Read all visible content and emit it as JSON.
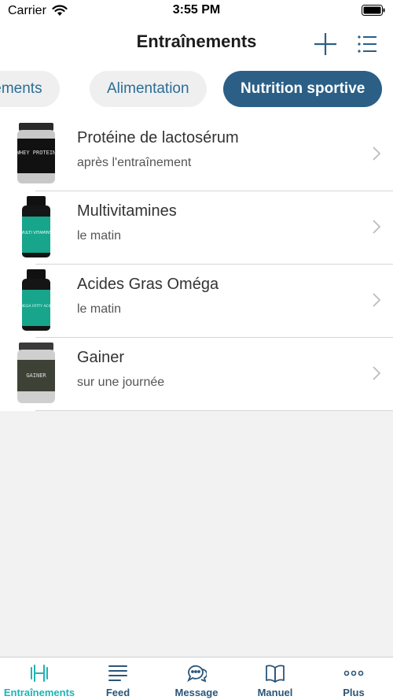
{
  "status_bar": {
    "carrier": "Carrier",
    "time": "3:55 PM"
  },
  "nav": {
    "title": "Entraînements"
  },
  "chips": [
    {
      "label": "Entraînements"
    },
    {
      "label": "Alimentation"
    },
    {
      "label": "Nutrition sportive"
    }
  ],
  "items": [
    {
      "title": "Protéine de lactosérum",
      "subtitle": "après l'entraînement",
      "image_text": "WHEY PROTEIN"
    },
    {
      "title": "Multivitamines",
      "subtitle": "le matin",
      "image_text": "MULTI VITAMINS"
    },
    {
      "title": "Acides Gras Oméga",
      "subtitle": "le matin",
      "image_text": "OMEGA FATTY ACIDS"
    },
    {
      "title": "Gainer",
      "subtitle": "sur une journée",
      "image_text": "GAINER"
    }
  ],
  "tabs": [
    {
      "label": "Entraînements",
      "icon": "dumbbell-icon"
    },
    {
      "label": "Feed",
      "icon": "feed-icon"
    },
    {
      "label": "Message",
      "icon": "message-icon"
    },
    {
      "label": "Manuel",
      "icon": "book-icon"
    },
    {
      "label": "Plus",
      "icon": "more-icon"
    }
  ],
  "colors": {
    "accent": "#1fb3b3",
    "chip_active": "#2b5f86",
    "chip_text": "#2a6e96",
    "tab_text": "#2a5578"
  }
}
